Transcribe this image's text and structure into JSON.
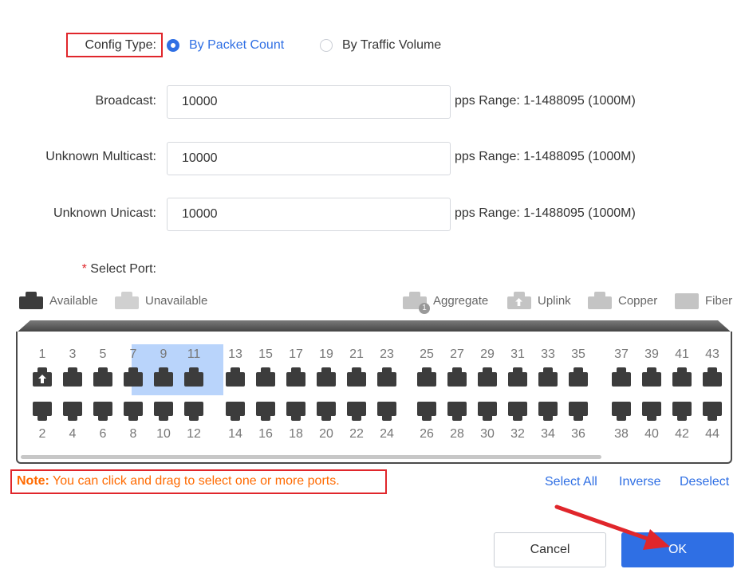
{
  "config_type": {
    "label": "Config Type:",
    "options": [
      {
        "label": "By Packet Count",
        "checked": true
      },
      {
        "label": "By Traffic Volume",
        "checked": false
      }
    ]
  },
  "fields": {
    "broadcast": {
      "label": "Broadcast:",
      "value": "10000",
      "hint": "pps Range: 1-1488095 (1000M)"
    },
    "unknown_multicast": {
      "label": "Unknown Multicast:",
      "value": "10000",
      "hint": "pps Range: 1-1488095 (1000M)"
    },
    "unknown_unicast": {
      "label": "Unknown Unicast:",
      "value": "10000",
      "hint": "pps Range: 1-1488095 (1000M)"
    }
  },
  "select_port": {
    "required_mark": "*",
    "label": "Select Port:"
  },
  "legend": {
    "available": "Available",
    "unavailable": "Unavailable",
    "aggregate": "Aggregate",
    "aggregate_badge": "1",
    "uplink": "Uplink",
    "copper": "Copper",
    "fiber": "Fiber"
  },
  "ports": {
    "top": [
      "1",
      "3",
      "5",
      "7",
      "9",
      "11",
      "13",
      "15",
      "17",
      "19",
      "21",
      "23",
      "25",
      "27",
      "29",
      "31",
      "33",
      "35",
      "37",
      "39",
      "41",
      "43"
    ],
    "bottom": [
      "2",
      "4",
      "6",
      "8",
      "10",
      "12",
      "14",
      "16",
      "18",
      "20",
      "22",
      "24",
      "26",
      "28",
      "30",
      "32",
      "34",
      "36",
      "38",
      "40",
      "42",
      "44"
    ],
    "selected": [
      "7",
      "9",
      "11"
    ],
    "uplink": [
      "1"
    ]
  },
  "note": {
    "prefix": "Note:",
    "text": " You can click and drag to select one or more ports."
  },
  "actions": {
    "select_all": "Select All",
    "inverse": "Inverse",
    "deselect": "Deselect"
  },
  "buttons": {
    "cancel": "Cancel",
    "ok": "OK"
  },
  "colors": {
    "accent": "#2f6fe4",
    "note": "#ff6a00",
    "highlight": "#e0262b",
    "port": "#3c3c3c",
    "selected_bg": "#b9d4fb"
  }
}
